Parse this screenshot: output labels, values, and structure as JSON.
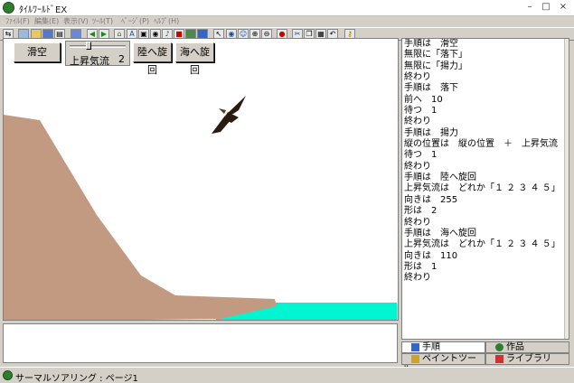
{
  "window": {
    "title": "ﾀｲﾙﾜｰﾙﾄﾞEX",
    "minimize": "–",
    "maximize": "□",
    "close": "×"
  },
  "menu": [
    "ﾌｧｲﾙ(F)",
    "編集(E)",
    "表示(V)",
    "ﾂｰﾙ(T)",
    "ﾍﾟｰｼﾞ(P)",
    "ﾍﾙﾌﾟ(H)"
  ],
  "toolbar_icons": [
    "switch-icon",
    "camera-icon",
    "open-folder-icon",
    "save-icon",
    "print-icon",
    "grid-icon",
    "arrow-left-icon",
    "arrow-right-icon",
    "home-icon",
    "text-a-icon",
    "layer-icon",
    "eye-icon",
    "music-icon",
    "stop-icon",
    "object-icon",
    "paint-icon",
    "pointer-icon",
    "view-icon",
    "person-icon",
    "zoom-in-icon",
    "zoom-out-icon",
    "record-icon",
    "scissors-icon",
    "copy-icon",
    "paste-icon",
    "undo-icon",
    "key-icon"
  ],
  "stage": {
    "buttons": {
      "glide": "滑空",
      "land_turn": "陸へ旋回",
      "sea_turn": "海へ旋回"
    },
    "slider": {
      "label": "上昇気流",
      "value": "2",
      "level": 0.33
    },
    "colors": {
      "cliff": "#c29a82",
      "sea": "#00f5d0",
      "bird": "#2a1a10"
    }
  },
  "code_lines": [
    "手順は　滑空",
    "無限に「落下」",
    "無限に「揚力」",
    "終わり",
    "手順は　落下",
    "前へ　10",
    "待つ　1",
    "終わり",
    "手順は　揚力",
    "縦の位置は　縦の位置　＋　上昇気流",
    "待つ　1",
    "終わり",
    "手順は　陸へ旋回",
    "上昇気流は　どれか「１ ２ ３ ４ ５」",
    "向きは　255",
    "形は　2",
    "終わり",
    "手順は　海へ旋回",
    "上昇気流は　どれか「１ ２ ３ ４ ５」",
    "向きは　110",
    "形は　1",
    "終わり"
  ],
  "tabs": {
    "procedure": "手順",
    "works": "作品",
    "paint_tool": "ペイントツール",
    "library": "ライブラリ"
  },
  "status": "サーマルソアリング : ページ1"
}
